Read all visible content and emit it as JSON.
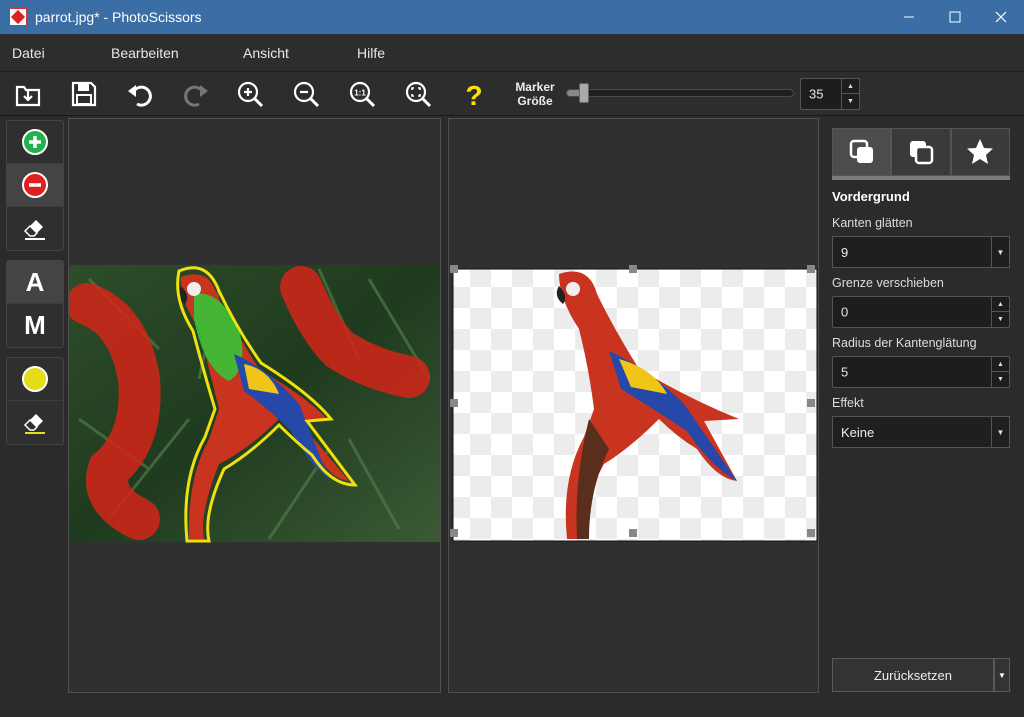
{
  "window": {
    "title": "parrot.jpg* - PhotoScissors"
  },
  "menu": {
    "items": [
      "Datei",
      "Bearbeiten",
      "Ansicht",
      "Hilfe"
    ]
  },
  "toolbar": {
    "marker_label_1": "Marker",
    "marker_label_2": "Größe",
    "marker_size": "35",
    "marker_fraction": 0.04
  },
  "side": {
    "title": "Vordergrund",
    "smooth_label": "Kanten glätten",
    "smooth_value": "9",
    "shift_label": "Grenze verschieben",
    "shift_value": "0",
    "radius_label": "Radius der Kantenglätung",
    "radius_value": "5",
    "effect_label": "Effekt",
    "effect_value": "Keine",
    "reset_label": "Zurücksetzen"
  },
  "colors": {
    "accent": "#3b6ea5",
    "add_marker": "#22b14c",
    "remove_marker": "#e02020",
    "boundary": "#f0e010"
  },
  "icons": [
    "open-icon",
    "save-icon",
    "undo-icon",
    "redo-icon",
    "zoom-in-icon",
    "zoom-out-icon",
    "zoom-actual-icon",
    "zoom-fit-icon",
    "help-icon"
  ]
}
